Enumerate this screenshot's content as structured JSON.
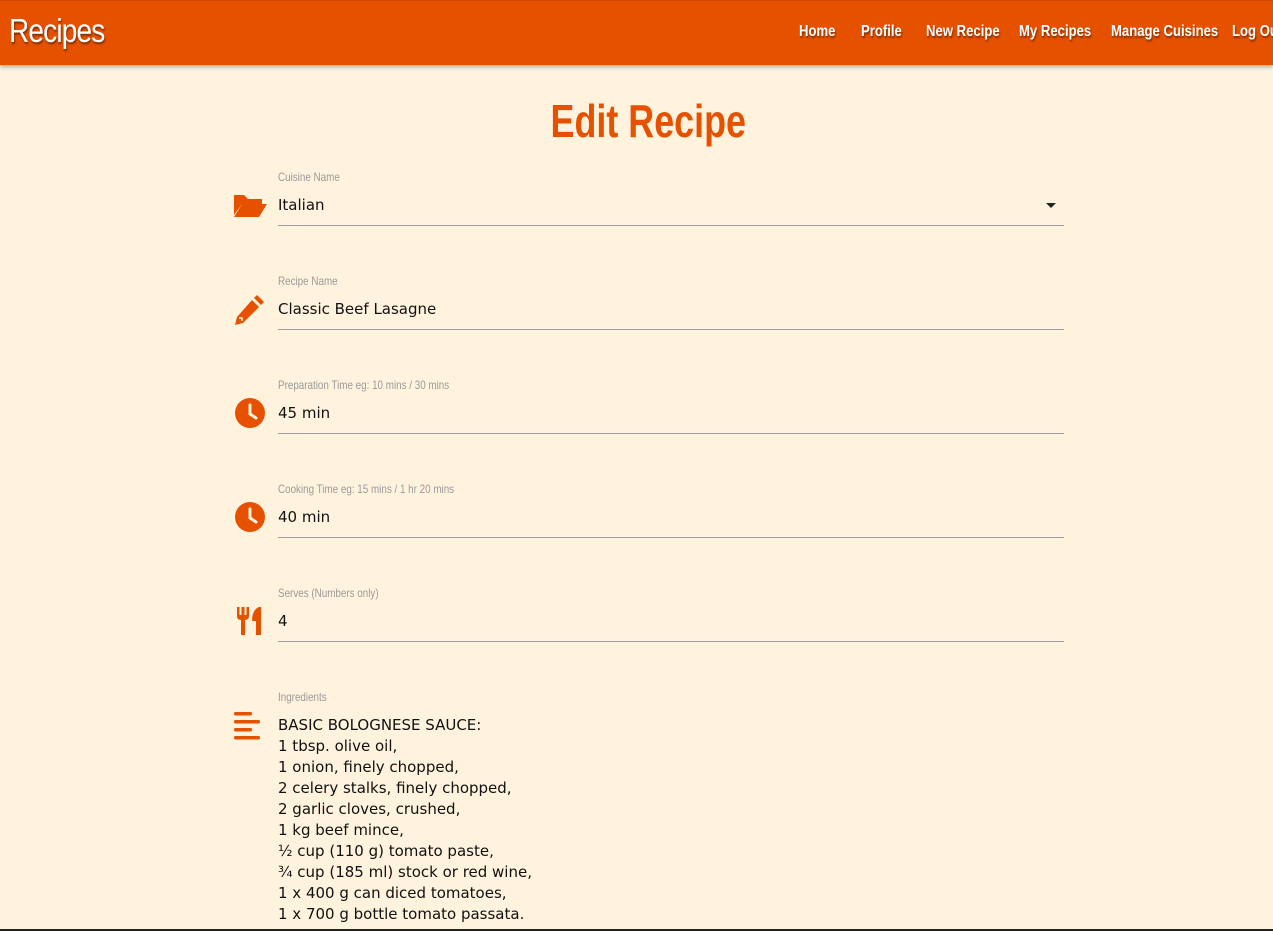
{
  "navbar": {
    "brand": "Recipes",
    "links": [
      "Home",
      "Profile",
      "New Recipe",
      "My Recipes",
      "Manage Cuisines",
      "Log Out"
    ]
  },
  "page": {
    "title": "Edit Recipe"
  },
  "form": {
    "cuisine": {
      "label": "Cuisine Name",
      "value": "Italian"
    },
    "recipe_name": {
      "label": "Recipe Name",
      "value": "Classic Beef Lasagne"
    },
    "prep_time": {
      "label": "Preparation Time eg: 10 mins / 30 mins",
      "value": "45 min"
    },
    "cooking_time": {
      "label": "Cooking Time eg: 15 mins / 1 hr 20 mins",
      "value": "40 min"
    },
    "serves": {
      "label": "Serves (Numbers only)",
      "value": "4"
    },
    "ingredients": {
      "label": "Ingredients",
      "lines": [
        "BASIC BOLOGNESE SAUCE:",
        "1 tbsp. olive oil,",
        "1 onion, finely chopped,",
        "2 celery stalks, finely chopped,",
        "2 garlic cloves, crushed,",
        "1 kg beef mince,",
        "½ cup (110 g) tomato paste,",
        "¾ cup (185 ml) stock or red wine,",
        "1 x 400 g can diced tomatoes,",
        "1 x 700 g bottle tomato passata."
      ]
    }
  },
  "colors": {
    "accent": "#e65100",
    "background": "#fff3de"
  },
  "icons": {
    "cuisine": "folder-open-icon",
    "recipe_name": "pencil-icon",
    "prep_time": "clock-icon",
    "cooking_time": "clock-icon",
    "serves": "utensils-icon",
    "ingredients": "align-left-icon"
  }
}
